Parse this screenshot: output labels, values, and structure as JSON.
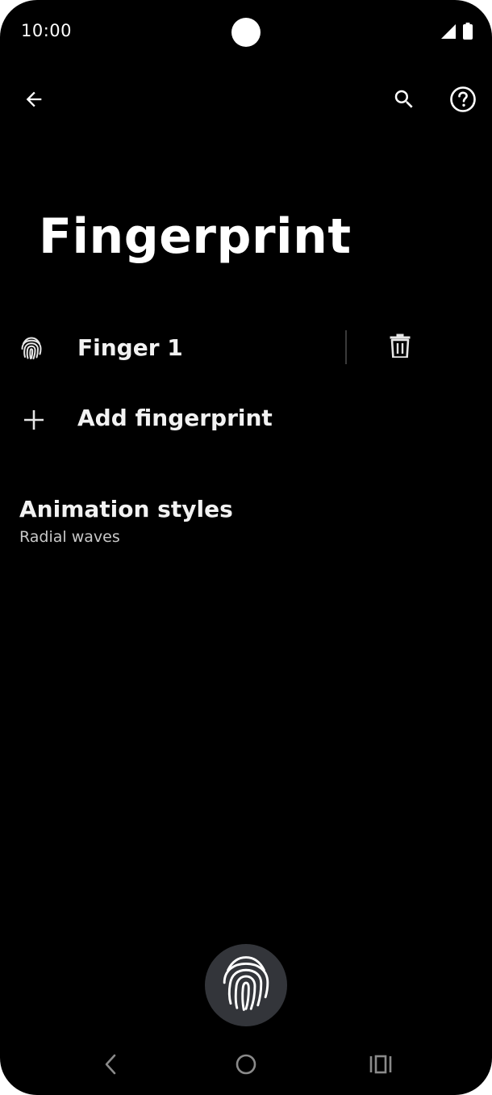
{
  "status_bar": {
    "time": "10:00",
    "icons": [
      "signal-icon",
      "battery-icon"
    ]
  },
  "toolbar": {
    "back_icon": "arrow-back-icon",
    "search_icon": "search-icon",
    "help_icon": "help-icon"
  },
  "page": {
    "title": "Fingerprint"
  },
  "fingerprints": [
    {
      "label": "Finger 1",
      "icon": "fingerprint-icon",
      "action_icon": "delete-icon"
    }
  ],
  "add_fingerprint": {
    "label": "Add fingerprint",
    "icon": "plus-icon"
  },
  "animation_styles": {
    "title": "Animation styles",
    "summary": "Radial waves"
  },
  "sensor_button": {
    "icon": "fingerprint-icon"
  },
  "nav_bar": {
    "icons": [
      "nav-back-icon",
      "nav-home-icon",
      "nav-recents-icon"
    ]
  },
  "colors": {
    "background": "#000000",
    "text": "#ffffff",
    "secondary_text": "#c8c8c8",
    "sensor_circle": "#33353a"
  }
}
